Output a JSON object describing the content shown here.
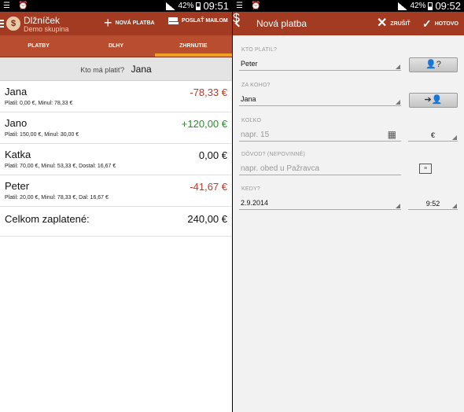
{
  "left_screen": {
    "status": {
      "battery": "42%",
      "time": "09:51"
    },
    "app": {
      "title": "Dlžníček",
      "subtitle": "Demo skupina",
      "icon_text": "$"
    },
    "actions": {
      "new_payment": "NOVÁ PLATBA",
      "send_email": "POSLAŤ MAILOM"
    },
    "tabs": [
      {
        "label": "PLATBY",
        "active": false
      },
      {
        "label": "DLHY",
        "active": false
      },
      {
        "label": "ZHRNUTIE",
        "active": true
      }
    ],
    "who_should_pay": {
      "label": "Kto má platiť?",
      "name": "Jana"
    },
    "people": [
      {
        "name": "Jana",
        "detail": "Platil: 0,00 €, Minul: 78,33 €",
        "amount": "-78,33 €",
        "color": "#c0392b"
      },
      {
        "name": "Jano",
        "detail": "Platil: 150,00 €, Minul: 30,00 €",
        "amount": "+120,00 €",
        "color": "#2e8b2e"
      },
      {
        "name": "Katka",
        "detail": "Platil: 70,00 €, Minul: 53,33 €, Dostal: 16,67 €",
        "amount": "0,00 €",
        "color": "#111111"
      },
      {
        "name": "Peter",
        "detail": "Platil: 20,00 €, Minul: 78,33 €, Dal: 16,67 €",
        "amount": "-41,67 €",
        "color": "#c0392b"
      }
    ],
    "total": {
      "label": "Celkom zaplatené:",
      "value": "240,00 €"
    }
  },
  "right_screen": {
    "status": {
      "battery": "42%",
      "time": "09:52"
    },
    "title": "Nová platba",
    "actions": {
      "cancel": "ZRUŠIŤ",
      "done": "HOTOVO"
    },
    "form": {
      "who_paid": {
        "label": "KTO PLATIL?",
        "value": "Peter"
      },
      "for_whom": {
        "label": "ZA KOHO?",
        "value": "Jana"
      },
      "amount": {
        "label": "KOĽKO",
        "placeholder": "napr. 15",
        "currency": "€"
      },
      "reason": {
        "label": "DÔVOD? (NEPOVINNÉ)",
        "placeholder": "napr. obed u Pažravca"
      },
      "when": {
        "label": "KEDY?",
        "date": "2.9.2014",
        "time": "9:52"
      }
    },
    "accent_color": "#a33b22"
  }
}
